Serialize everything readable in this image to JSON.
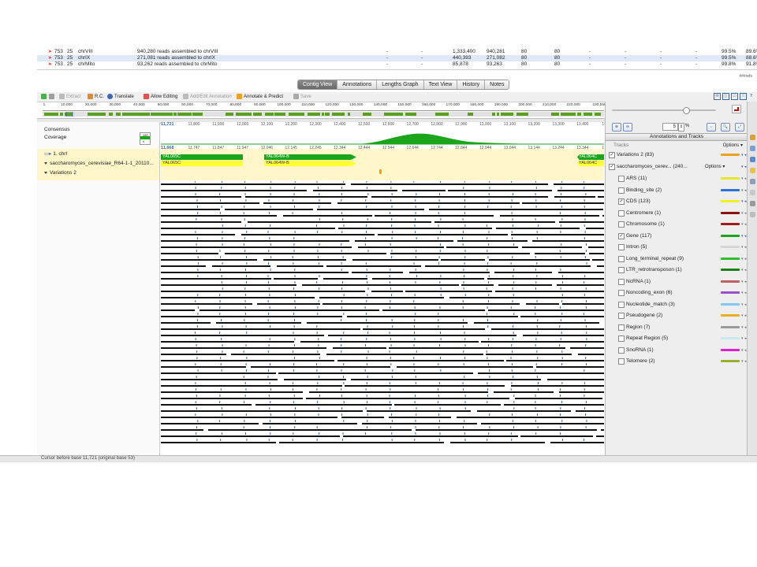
{
  "top_table": {
    "rows": [
      {
        "icon": "arrow-icon",
        "num": "753",
        "bp": "25",
        "name": "chrVIII",
        "desc": "940,280 reads assembled to chrVIII",
        "c1": "-",
        "c2": "-",
        "c3": "1,333,400",
        "c4": "940,281",
        "c5": "80",
        "c6": "80",
        "c7": "-",
        "c8": "-",
        "c9": "-",
        "c10": "-",
        "p1": "99.5%",
        "p2": "89.6%"
      },
      {
        "icon": "arrow-icon",
        "num": "753",
        "bp": "25",
        "name": "chrIX",
        "desc": "271,081 reads assembled to chrIX",
        "c1": "-",
        "c2": "-",
        "c3": "440,393",
        "c4": "271,082",
        "c5": "80",
        "c6": "80",
        "c7": "-",
        "c8": "-",
        "c9": "-",
        "c10": "-",
        "p1": "99.5%",
        "p2": "88.6%"
      },
      {
        "icon": "arrow-icon",
        "num": "753",
        "bp": "25",
        "name": "chrMito",
        "desc": "93,262 reads assembled to chrMito",
        "c1": "-",
        "c2": "-",
        "c3": "85,878",
        "c4": "93,263",
        "c5": "80",
        "c6": "80",
        "c7": "-",
        "c8": "-",
        "c9": "-",
        "c10": "-",
        "p1": "99.8%",
        "p2": "91.8%"
      }
    ],
    "ref_count": "###refs"
  },
  "tabs": [
    "Contig View",
    "Annotations",
    "Lengths Graph",
    "Text View",
    "History",
    "Notes"
  ],
  "toolbar": {
    "extract": "Extract",
    "rc": "R.C.",
    "translate": "Translate",
    "allow_editing": "Allow Editing",
    "add_edit_annotation": "Add/Edit Annotation",
    "annotate_predict": "Annotate & Predict",
    "save": "Save"
  },
  "overview_ruler": [
    "1",
    "10,000",
    "20,000",
    "30,000",
    "40,000",
    "50,000",
    "60,000",
    "70,000",
    "80,000",
    "90,000",
    "100,000",
    "110,000",
    "120,000",
    "130,000",
    "140,000",
    "150,000",
    "160,000",
    "170,000",
    "180,000",
    "190,000",
    "200,000",
    "210,000",
    "220,000",
    "230,550"
  ],
  "left_labels": {
    "consensus": "Consensus",
    "coverage": "Coverage",
    "cov_scale_max": "280",
    "cov_scale_min": "0",
    "contig": "1. chrI",
    "annotation_track": "saccharomyces_cerevisiae_R64-1-1_20110...",
    "variations": "Variations 2"
  },
  "detail": {
    "start_pos": "11,721",
    "positions": [
      "11,800",
      "11,900",
      "12,000",
      "12,100",
      "12,200",
      "12,300",
      "12,400",
      "12,500",
      "12,600",
      "12,700",
      "12,800",
      "12,900",
      "13,000",
      "13,100",
      "13,200",
      "13,300",
      "13,400",
      "13,50"
    ],
    "consensus_start": "11,668",
    "positions2": [
      "11,747",
      "11,847",
      "11,947",
      "12,046",
      "12,145",
      "12,245",
      "12,344",
      "12,444",
      "12,544",
      "12,644",
      "12,744",
      "12,844",
      "12,944",
      "13,044",
      "13,144",
      "13,244",
      "13,344",
      "13,44"
    ],
    "genes": [
      {
        "label": "YAL065C",
        "color": "green"
      },
      {
        "label": "YAL064W-B",
        "color": "green"
      },
      {
        "label": "YAL064C",
        "color": "green"
      }
    ],
    "cds": [
      {
        "label": "YAL065C",
        "color": "yellow"
      },
      {
        "label": "YAL064W-B",
        "color": "yellow"
      },
      {
        "label": "YAL064C",
        "color": "yellow"
      }
    ]
  },
  "right_panel": {
    "zoom_value": "5",
    "zoom_unit": "%",
    "title": "Annotations and Tracks",
    "tracks_header": "Tracks",
    "options_label": "Options",
    "top_tracks": [
      {
        "name": "Variations 2 (83)",
        "checked": true,
        "color": "#f0a020"
      },
      {
        "name": "saccharomyces_cerev... (240...",
        "checked": true,
        "color": null
      }
    ],
    "tracks": [
      {
        "name": "ARS (11)",
        "checked": false,
        "color": "#e6e62a"
      },
      {
        "name": "Binding_site (2)",
        "checked": false,
        "color": "#2a74d9"
      },
      {
        "name": "CDS (123)",
        "checked": true,
        "color": "#f2f21e"
      },
      {
        "name": "Centromere (1)",
        "checked": false,
        "color": "#8b1010"
      },
      {
        "name": "Chromosome (1)",
        "checked": false,
        "color": "#a01c1c"
      },
      {
        "name": "Gene (117)",
        "checked": true,
        "color": "#1aa51a"
      },
      {
        "name": "Intron (5)",
        "checked": false,
        "color": "#d6d6d6"
      },
      {
        "name": "Long_terminal_repeat (9)",
        "checked": false,
        "color": "#2fbf2f"
      },
      {
        "name": "LTR_retrotransposon (1)",
        "checked": false,
        "color": "#1b7f1b"
      },
      {
        "name": "NcRNA (1)",
        "checked": false,
        "color": "#c06060"
      },
      {
        "name": "Noncoding_exon (6)",
        "checked": false,
        "color": "#9a50c8"
      },
      {
        "name": "Nucleotide_match (3)",
        "checked": false,
        "color": "#7fc8f0"
      },
      {
        "name": "Pseudogene (2)",
        "checked": false,
        "color": "#e6b020"
      },
      {
        "name": "Region (7)",
        "checked": false,
        "color": "#9a9a9a"
      },
      {
        "name": "Repeat Region (5)",
        "checked": false,
        "color": "#c8e8f0"
      },
      {
        "name": "SnoRNA (1)",
        "checked": false,
        "color": "#e020d0"
      },
      {
        "name": "Telomere (2)",
        "checked": false,
        "color": "#9aae2a"
      }
    ]
  },
  "status_bar": "Cursor before base 11,721 (original base 53)"
}
